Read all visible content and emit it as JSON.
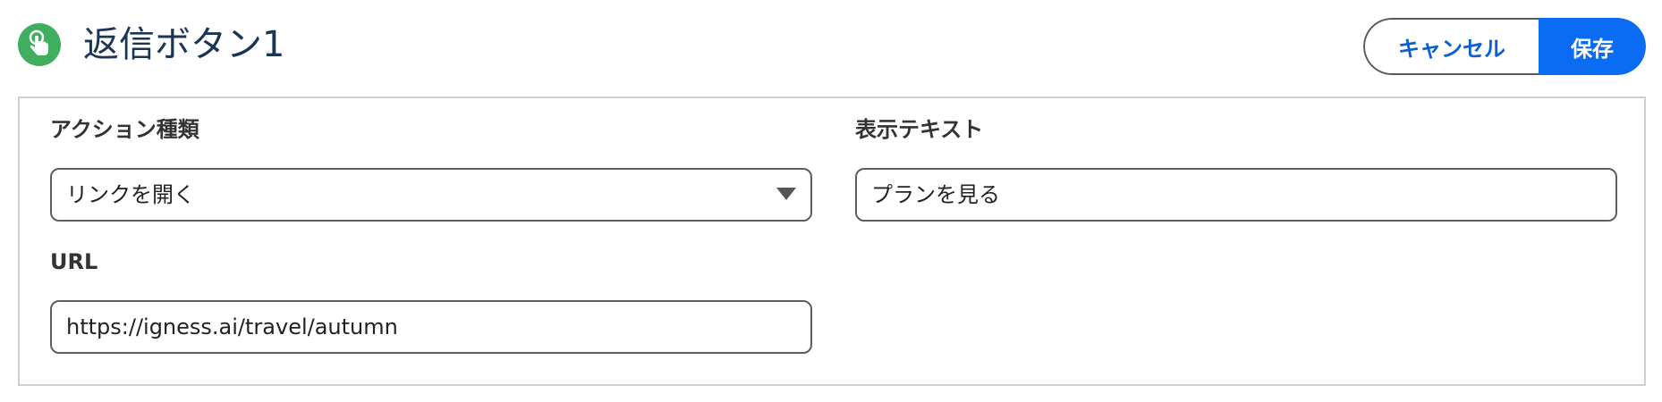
{
  "header": {
    "title": "返信ボタン1",
    "icon": "touch-hand-icon",
    "icon_color": "#3fae5f",
    "cancel_label": "キャンセル",
    "save_label": "保存",
    "accent_color": "#0a6cf2"
  },
  "form": {
    "action_type": {
      "label": "アクション種類",
      "value": "リンクを開く"
    },
    "display_text": {
      "label": "表示テキスト",
      "value": "プランを見る"
    },
    "url": {
      "label": "URL",
      "value": "https://igness.ai/travel/autumn"
    }
  }
}
